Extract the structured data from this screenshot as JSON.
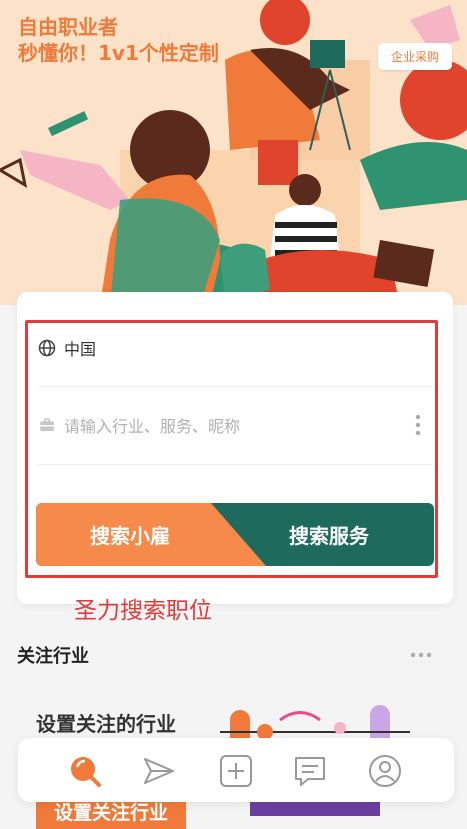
{
  "hero": {
    "title_line1": "自由职业者",
    "title_line2": "秒懂你！1v1个性定制",
    "corp_button": "企业采购"
  },
  "search_card": {
    "country": "中国",
    "search_placeholder": "请输入行业、服务、昵称",
    "btn_left": "搜索小雇",
    "btn_right": "搜索服务"
  },
  "annotation": "圣力搜索职位",
  "follow": {
    "title": "关注行业",
    "card_title": "设置关注的行业",
    "card_button": "设置关注行业"
  },
  "tabbar": {
    "tabs": [
      "home",
      "send",
      "add",
      "messages",
      "profile"
    ],
    "active": "home"
  },
  "colors": {
    "brand_orange": "#f07a3a",
    "brand_green": "#1e6b5e",
    "annotation_red": "#e23b3b"
  }
}
